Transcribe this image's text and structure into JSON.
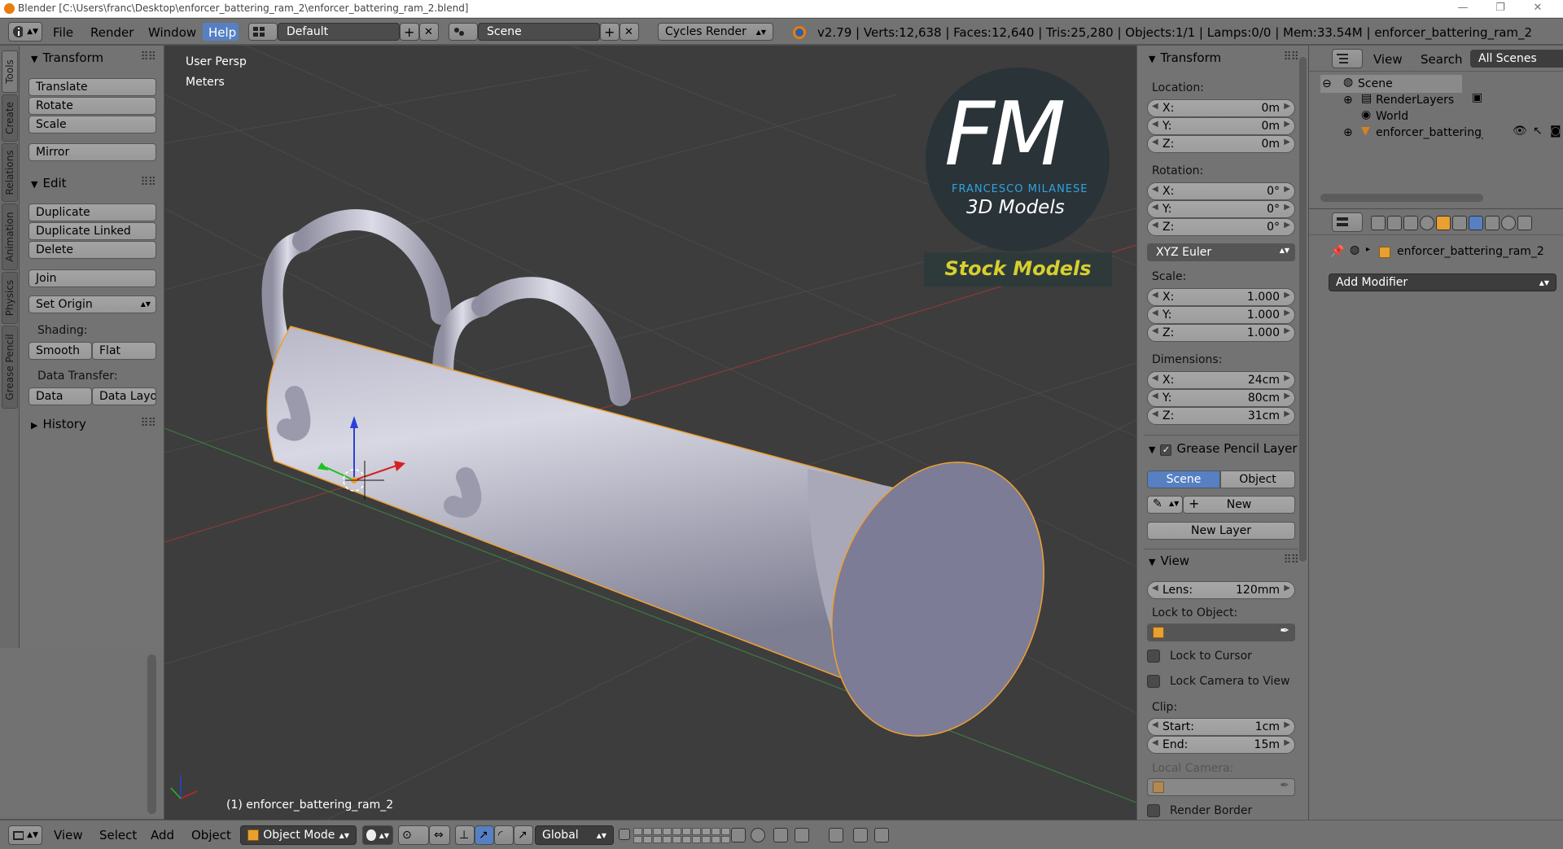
{
  "window": {
    "title": "Blender [C:\\Users\\franc\\Desktop\\enforcer_battering_ram_2\\enforcer_battering_ram_2.blend]",
    "minimize": "—",
    "maximize": "❐",
    "close": "✕"
  },
  "header": {
    "menus": [
      "File",
      "Render",
      "Window",
      "Help"
    ],
    "screen_layout": "Default",
    "scene": "Scene",
    "render_engine": "Cycles Render",
    "stats": "v2.79 | Verts:12,638 | Faces:12,640 | Tris:25,280 | Objects:1/1 | Lamps:0/0 | Mem:33.54M | enforcer_battering_ram_2"
  },
  "left_tabs": [
    "Tools",
    "Create",
    "Relations",
    "Animation",
    "Physics",
    "Grease Pencil"
  ],
  "tool_shelf": {
    "transform": {
      "title": "Transform",
      "buttons": [
        "Translate",
        "Rotate",
        "Scale",
        "Mirror"
      ]
    },
    "edit": {
      "title": "Edit",
      "buttons": [
        "Duplicate",
        "Duplicate Linked",
        "Delete",
        "Join",
        "Set Origin"
      ]
    },
    "shading": {
      "label": "Shading:",
      "smooth": "Smooth",
      "flat": "Flat"
    },
    "data_transfer": {
      "label": "Data Transfer:",
      "data": "Data",
      "data_layout": "Data Layo"
    },
    "history": {
      "title": "History"
    }
  },
  "viewport": {
    "view_name": "User Persp",
    "units": "Meters",
    "object_label": "(1) enforcer_battering_ram_2",
    "watermark": {
      "monogram": "FM",
      "name": "FRANCESCO MILANESE",
      "subtitle": "3D Models",
      "banner": "Stock Models"
    }
  },
  "properties_panel": {
    "transform_title": "Transform",
    "location_label": "Location:",
    "location": [
      {
        "axis": "X:",
        "value": "0m"
      },
      {
        "axis": "Y:",
        "value": "0m"
      },
      {
        "axis": "Z:",
        "value": "0m"
      }
    ],
    "rotation_label": "Rotation:",
    "rotation": [
      {
        "axis": "X:",
        "value": "0°"
      },
      {
        "axis": "Y:",
        "value": "0°"
      },
      {
        "axis": "Z:",
        "value": "0°"
      }
    ],
    "rotation_mode": "XYZ Euler",
    "scale_label": "Scale:",
    "scale": [
      {
        "axis": "X:",
        "value": "1.000"
      },
      {
        "axis": "Y:",
        "value": "1.000"
      },
      {
        "axis": "Z:",
        "value": "1.000"
      }
    ],
    "dimensions_label": "Dimensions:",
    "dimensions": [
      {
        "axis": "X:",
        "value": "24cm"
      },
      {
        "axis": "Y:",
        "value": "80cm"
      },
      {
        "axis": "Z:",
        "value": "31cm"
      }
    ],
    "grease_pencil_title": "Grease Pencil Layer",
    "gp_scene": "Scene",
    "gp_object": "Object",
    "gp_new": "New",
    "gp_new_layer": "New Layer",
    "view_title": "View",
    "lens_label": "Lens:",
    "lens_value": "120mm",
    "lock_to_object": "Lock to Object:",
    "lock_to_cursor": "Lock to Cursor",
    "lock_camera": "Lock Camera to View",
    "clip_label": "Clip:",
    "clip_start_label": "Start:",
    "clip_start": "1cm",
    "clip_end_label": "End:",
    "clip_end": "15m",
    "local_camera": "Local Camera:",
    "render_border": "Render Border"
  },
  "outliner": {
    "menus": [
      "View",
      "Search"
    ],
    "filter": "All Scenes",
    "items": [
      {
        "label": "Scene"
      },
      {
        "label": "RenderLayers"
      },
      {
        "label": "World"
      },
      {
        "label": "enforcer_battering_ran"
      }
    ]
  },
  "modifier_panel": {
    "object_name": "enforcer_battering_ram_2",
    "add_modifier": "Add Modifier"
  },
  "bottom_bar": {
    "menus": [
      "View",
      "Select",
      "Add",
      "Object"
    ],
    "mode": "Object Mode",
    "orientation": "Global"
  },
  "colors": {
    "selection_outline": "#f0a030",
    "viewport_bg": "#3d3d3d",
    "panel_bg": "#737373",
    "active_blue": "#5680c2",
    "help_active": "#5680c2"
  }
}
